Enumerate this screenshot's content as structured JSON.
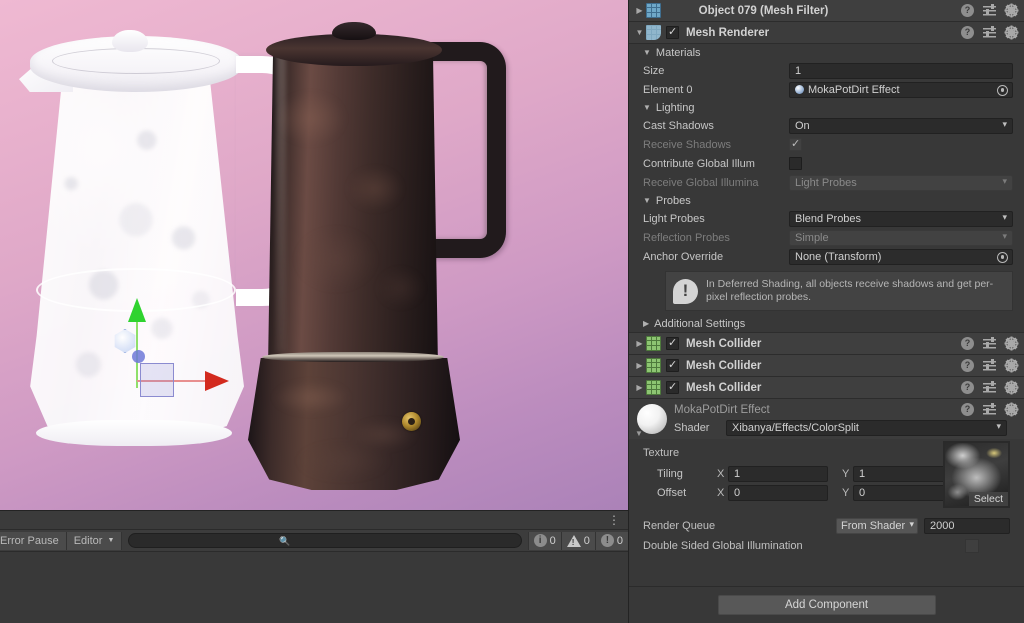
{
  "scene": {
    "name": "scene-viewport",
    "gizmo": {
      "type": "move-gizmo",
      "axis_x_color": "#d32a1e",
      "axis_y_color": "#2fd32f",
      "axis_z_color": "#6f78d8"
    },
    "background_top": "#efb9d2",
    "background_bottom": "#ab82b8"
  },
  "console": {
    "error_pause_label": "Error Pause",
    "editor_label": "Editor",
    "search_placeholder": "",
    "counters": [
      {
        "icon": "info-icon",
        "count": "0"
      },
      {
        "icon": "warning-icon",
        "count": "0"
      },
      {
        "icon": "error-icon",
        "count": "0"
      }
    ],
    "kebab": "⋮"
  },
  "inspector": {
    "mesh_filter": {
      "title": "Object 079 (Mesh Filter)",
      "icon": "mesh-filter-icon",
      "expanded": false
    },
    "mesh_renderer": {
      "title": "Mesh Renderer",
      "icon": "mesh-renderer-icon",
      "enabled": true,
      "materials": {
        "section_label": "Materials",
        "size_label": "Size",
        "size_value": "1",
        "element_label": "Element 0",
        "element_value": "MokaPotDirt Effect"
      },
      "lighting": {
        "section_label": "Lighting",
        "cast_shadows_label": "Cast Shadows",
        "cast_shadows_value": "On",
        "receive_shadows_label": "Receive Shadows",
        "receive_shadows_checked": true,
        "contribute_gi_label": "Contribute Global Illum",
        "contribute_gi_checked": false,
        "receive_gi_label": "Receive Global Illumina",
        "receive_gi_value": "Light Probes"
      },
      "probes": {
        "section_label": "Probes",
        "light_probes_label": "Light Probes",
        "light_probes_value": "Blend Probes",
        "reflection_probes_label": "Reflection Probes",
        "reflection_probes_value": "Simple",
        "anchor_override_label": "Anchor Override",
        "anchor_override_value": "None (Transform)"
      },
      "info_message": "In Deferred Shading, all objects receive shadows and get per-pixel reflection probes.",
      "additional_settings_label": "Additional Settings"
    },
    "mesh_colliders": [
      {
        "title": "Mesh Collider",
        "enabled": true
      },
      {
        "title": "Mesh Collider",
        "enabled": true
      },
      {
        "title": "Mesh Collider",
        "enabled": true
      }
    ],
    "material": {
      "name": "MokaPotDirt Effect",
      "shader_label": "Shader",
      "shader_value": "Xibanya/Effects/ColorSplit",
      "texture_label": "Texture",
      "tiling_label": "Tiling",
      "tiling_x_label": "X",
      "tiling_x": "1",
      "tiling_y_label": "Y",
      "tiling_y": "1",
      "offset_label": "Offset",
      "offset_x_label": "X",
      "offset_x": "0",
      "offset_y_label": "Y",
      "offset_y": "0",
      "texture_select_label": "Select",
      "render_queue_label": "Render Queue",
      "render_queue_mode": "From Shader",
      "render_queue_value": "2000",
      "double_sided_gi_label": "Double Sided Global Illumination",
      "double_sided_gi_checked": false
    },
    "add_component_label": "Add Component"
  }
}
